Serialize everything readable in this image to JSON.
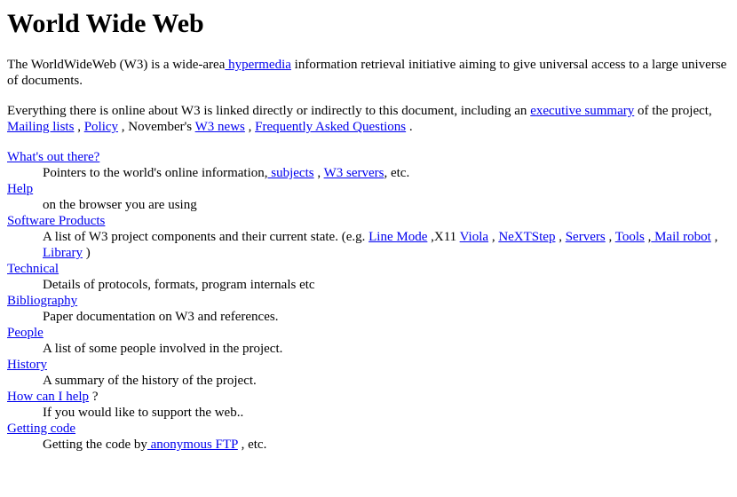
{
  "title": "World Wide Web",
  "intro": {
    "t1": "The WorldWideWeb (W3) is a wide-area",
    "link_hypermedia": " hypermedia",
    "t2": " information retrieval initiative aiming to give universal access to a large universe of documents."
  },
  "everything": {
    "t1": "Everything there is online about W3 is linked directly or indirectly to this document, including an ",
    "link_exec": "executive summary",
    "t2": " of the project, ",
    "link_mailing": "Mailing lists",
    "t3": " , ",
    "link_policy": "Policy",
    "t4": " , November's ",
    "link_news": "W3 news",
    "t5": " , ",
    "link_faq": "Frequently Asked Questions",
    "t6": " ."
  },
  "sections": {
    "whats_out": {
      "term": "What's out there?",
      "d1": "Pointers to the world's online information,",
      "link_subjects": " subjects",
      "d2": " , ",
      "link_servers": "W3 servers",
      "d3": ", etc."
    },
    "help": {
      "term": "Help",
      "desc": "on the browser you are using"
    },
    "software": {
      "term": "Software Products",
      "d1": "A list of W3 project components and their current state. (e.g. ",
      "link_linemode": "Line Mode",
      "d2": " ,X11 ",
      "link_viola": "Viola",
      "d3": " , ",
      "link_nextstep": "NeXTStep",
      "d4": " , ",
      "link_servers": "Servers",
      "d5": " , ",
      "link_tools": "Tools",
      "d6": " ,",
      "link_mailrobot": " Mail robot",
      "d7": " ,",
      "link_library": " Library",
      "d8": " )"
    },
    "technical": {
      "term": "Technical",
      "desc": "Details of protocols, formats, program internals etc"
    },
    "bibliography": {
      "term": "Bibliography",
      "desc": "Paper documentation on W3 and references."
    },
    "people": {
      "term": "People",
      "desc": "A list of some people involved in the project."
    },
    "history": {
      "term": "History",
      "desc": "A summary of the history of the project."
    },
    "howhelp": {
      "term": "How can I help",
      "after": " ?",
      "desc": "If you would like to support the web.."
    },
    "gettingcode": {
      "term": "Getting code",
      "d1": "Getting the code by",
      "link_ftp": " anonymous FTP",
      "d2": " , etc."
    }
  },
  "colors": {
    "link": "#0000ee",
    "text": "#000000",
    "background": "#ffffff"
  }
}
